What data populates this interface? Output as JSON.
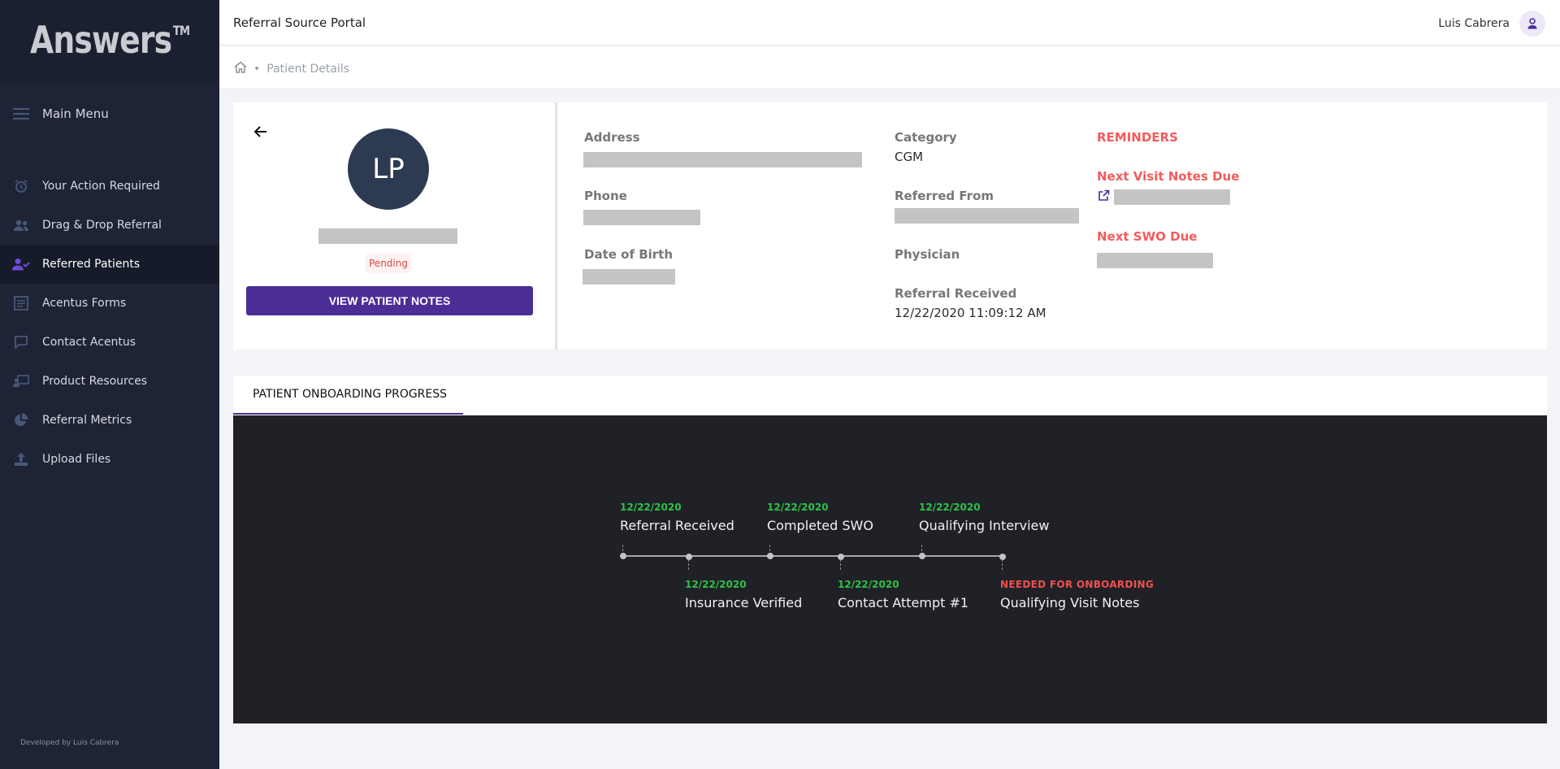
{
  "app": {
    "logo_text": "Answers",
    "logo_tm": "TM",
    "portal_title": "Referral Source Portal",
    "user_name": "Luis Cabrera"
  },
  "sidebar": {
    "main_menu_label": "Main Menu",
    "items": [
      {
        "label": "Your Action Required",
        "icon": "alarm-clock-icon"
      },
      {
        "label": "Drag & Drop Referral",
        "icon": "users-icon"
      },
      {
        "label": "Referred Patients",
        "icon": "user-check-icon",
        "active": true
      },
      {
        "label": "Acentus Forms",
        "icon": "form-icon"
      },
      {
        "label": "Contact Acentus",
        "icon": "chat-icon"
      },
      {
        "label": "Product Resources",
        "icon": "presenter-icon"
      },
      {
        "label": "Referral Metrics",
        "icon": "pie-chart-icon"
      },
      {
        "label": "Upload Files",
        "icon": "upload-icon"
      }
    ],
    "credit": "Developed by Luis Cabrera"
  },
  "breadcrumb": {
    "current": "Patient Details"
  },
  "patient": {
    "initials": "LP",
    "status": "Pending",
    "view_notes_label": "VIEW PATIENT NOTES",
    "fields": {
      "address_label": "Address",
      "phone_label": "Phone",
      "dob_label": "Date of Birth",
      "category_label": "Category",
      "category_value": "CGM",
      "referred_from_label": "Referred From",
      "physician_label": "Physician",
      "referral_received_label": "Referral Received",
      "referral_received_value": "12/22/2020 11:09:12 AM"
    },
    "reminders": {
      "heading": "REMINDERS",
      "next_visit_notes_label": "Next Visit Notes Due",
      "next_swo_label": "Next SWO Due"
    }
  },
  "onboarding": {
    "tab_label": "PATIENT ONBOARDING PROGRESS",
    "steps": [
      {
        "date": "12/22/2020",
        "label": "Referral Received"
      },
      {
        "date": "12/22/2020",
        "label": "Insurance Verified"
      },
      {
        "date": "12/22/2020",
        "label": "Completed SWO"
      },
      {
        "date": "12/22/2020",
        "label": "Contact Attempt #1"
      },
      {
        "date": "12/22/2020",
        "label": "Qualifying Interview"
      },
      {
        "date": "NEEDED FOR ONBOARDING",
        "label": "Qualifying Visit Notes"
      }
    ]
  },
  "colors": {
    "sidebar_bg": "#1e2436",
    "accent_purple": "#4b2d96",
    "reminder_red": "#f25c5c",
    "timeline_green": "#2ec24a",
    "progress_panel_bg": "#1f2126"
  }
}
